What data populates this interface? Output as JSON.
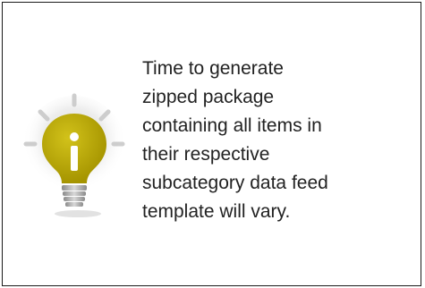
{
  "tip": {
    "icon": "lightbulb-info-icon",
    "lines": [
      "Time to generate",
      "zipped package",
      "containing all items in",
      "their respective",
      "subcategory data feed",
      "template will vary."
    ]
  },
  "colors": {
    "bulb": "#b5a400",
    "border": "#1a1a1a",
    "text": "#222222"
  }
}
